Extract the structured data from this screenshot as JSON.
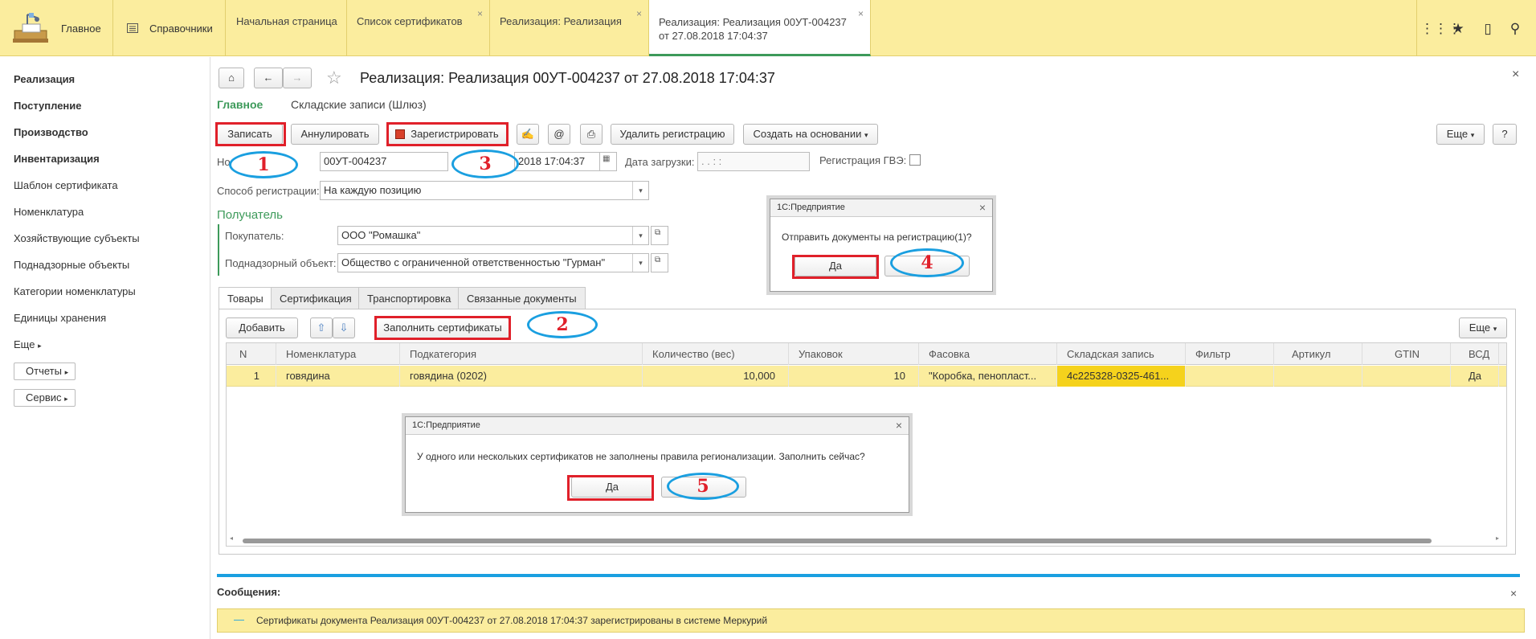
{
  "topbar": {
    "home_label": "Главное",
    "refs_label": "Справочники",
    "tabs": [
      {
        "label": "Начальная страница"
      },
      {
        "label": "Список сертификатов",
        "closable": true
      },
      {
        "label": "Реализация: Реализация",
        "closable": true
      },
      {
        "label_line1": "Реализация: Реализация 00УТ-004237",
        "label_line2": "от 27.08.2018 17:04:37",
        "closable": true,
        "active": true
      }
    ],
    "icons": [
      "apps-grid-icon",
      "star-icon",
      "history-icon",
      "search-icon"
    ]
  },
  "sidebar": {
    "items": [
      {
        "label": "Реализация",
        "bold": true
      },
      {
        "label": "Поступление",
        "bold": true
      },
      {
        "label": "Производство",
        "bold": true
      },
      {
        "label": "Инвентаризация",
        "bold": true
      },
      {
        "label": "Шаблон сертификата"
      },
      {
        "label": "Номенклатура"
      },
      {
        "label": "Хозяйствующие субъекты"
      },
      {
        "label": "Поднадзорные объекты"
      },
      {
        "label": "Категории номенклатуры"
      },
      {
        "label": "Единицы хранения"
      },
      {
        "label": "Еще"
      }
    ],
    "reports_button": "Отчеты",
    "service_button": "Сервис"
  },
  "document": {
    "title": "Реализация: Реализация 00УТ-004237 от 27.08.2018 17:04:37",
    "sections": {
      "main": "Главное",
      "warehouse": "Складские записи (Шлюз)"
    },
    "toolbar": {
      "save": "Записать",
      "cancel": "Аннулировать",
      "register": "Зарегистрировать",
      "delete_registration": "Удалить регистрацию",
      "create_based_on": "Создать на основании",
      "more": "Еще",
      "help": "?"
    },
    "form": {
      "number_label": "Но",
      "number_value": "00УТ-004237",
      "date_value": "2018 17:04:37",
      "load_date_label": "Дата загрузки:",
      "load_date_value": " .  .      :  :",
      "gve_label": "Регистрация ГВЭ:",
      "reg_method_label": "Способ регистрации:",
      "reg_method_value": "На каждую позицию",
      "recipient_header": "Получатель",
      "buyer_label": "Покупатель:",
      "buyer_value": "ООО \"Ромашка\"",
      "object_label": "Поднадзорный объект:",
      "object_value": "Общество с ограниченной ответственностью \"Гурман\""
    },
    "tabs": [
      "Товары",
      "Сертификация",
      "Транспортировка",
      "Связанные документы"
    ],
    "table_toolbar": {
      "add": "Добавить",
      "fill_certs": "Заполнить сертификаты",
      "more": "Еще"
    },
    "table": {
      "columns": [
        "N",
        "Номенклатура",
        "Подкатегория",
        "Количество (вес)",
        "Упаковок",
        "Фасовка",
        "Складская запись",
        "Фильтр",
        "Артикул",
        "GTIN",
        "ВСД"
      ],
      "rows": [
        [
          "1",
          "говядина",
          "говядина (0202)",
          "10,000",
          "10",
          "\"Коробка, пенопласт...",
          "4c225328-0325-461...",
          "",
          "",
          "",
          "Да"
        ]
      ]
    }
  },
  "dialog_register": {
    "title": "1С:Предприятие",
    "message": "Отправить документы на регистрацию(1)?",
    "yes": "Да",
    "no": ""
  },
  "dialog_fill": {
    "title": "1С:Предприятие",
    "message": "У одного или нескольких сертификатов не заполнены правила регионализации. Заполнить сейчас?",
    "yes": "Да",
    "no": ""
  },
  "messages": {
    "title": "Сообщения:",
    "text": "Сертификаты документа Реализация 00УТ-004237 от 27.08.2018 17:04:37 зарегистрированы в системе Меркурий"
  },
  "annotations": {
    "step1": "1",
    "step2": "2",
    "step3": "3",
    "step4": "4",
    "step5": "5"
  },
  "colors": {
    "topbar": "#fbed9e",
    "accent_green": "#3d9a5a",
    "highlight": "#fbed9e",
    "annotation_red": "#e0202a",
    "annotation_blue": "#1a9fe0"
  }
}
